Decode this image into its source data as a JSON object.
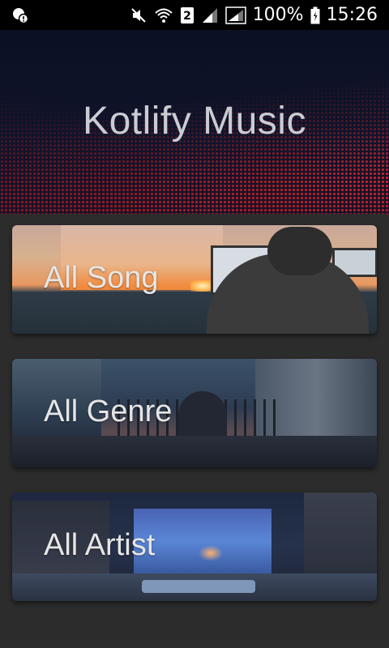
{
  "status_bar": {
    "sim_slot": "2",
    "battery": "100%",
    "time": "15:26",
    "icons": [
      "notification-icon",
      "mute-icon",
      "wifi-icon",
      "sim-badge-icon",
      "signal-icon",
      "signal-icon",
      "battery-icon"
    ]
  },
  "header": {
    "title": "Kotlify Music",
    "accent_color": "#e6282f"
  },
  "menu": {
    "items": [
      {
        "label": "All Song",
        "image": "sunset-desk-illustration"
      },
      {
        "label": "All Genre",
        "image": "night-window-illustration"
      },
      {
        "label": "All Artist",
        "image": "blue-room-illustration"
      }
    ]
  }
}
